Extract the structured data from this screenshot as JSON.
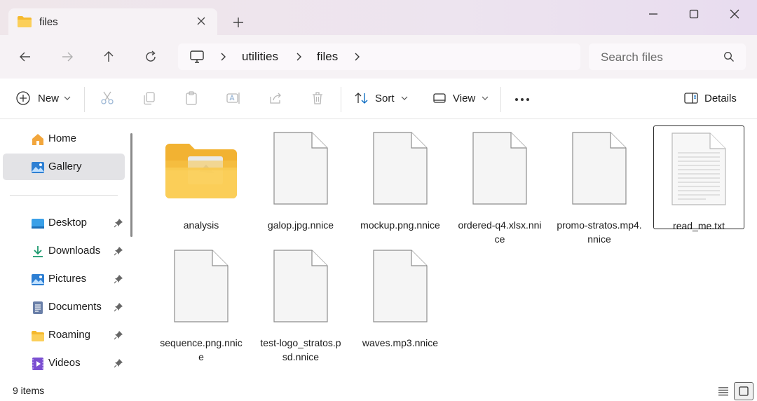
{
  "tab": {
    "title": "files"
  },
  "address": {
    "crumbs": [
      "utilities",
      "files"
    ]
  },
  "search": {
    "placeholder": "Search files"
  },
  "toolbar": {
    "new_label": "New",
    "sort_label": "Sort",
    "view_label": "View",
    "details_label": "Details"
  },
  "sidebar": {
    "items": [
      {
        "label": "Home",
        "icon": "home-icon"
      },
      {
        "label": "Gallery",
        "icon": "gallery-icon"
      },
      {
        "label": "Desktop",
        "icon": "desktop-icon"
      },
      {
        "label": "Downloads",
        "icon": "downloads-icon"
      },
      {
        "label": "Pictures",
        "icon": "pictures-icon"
      },
      {
        "label": "Documents",
        "icon": "documents-icon"
      },
      {
        "label": "Roaming",
        "icon": "folder-icon"
      },
      {
        "label": "Videos",
        "icon": "videos-icon"
      }
    ]
  },
  "files": [
    {
      "name": "analysis",
      "type": "folder"
    },
    {
      "name": "galop.jpg.nnice",
      "type": "file"
    },
    {
      "name": "mockup.png.nnice",
      "type": "file"
    },
    {
      "name": "ordered-q4.xlsx.nnice",
      "type": "file"
    },
    {
      "name": "promo-stratos.mp4.nnice",
      "type": "file"
    },
    {
      "name": "read_me.txt",
      "type": "text",
      "selected": true
    },
    {
      "name": "sequence.png.nnice",
      "type": "file"
    },
    {
      "name": "test-logo_stratos.psd.nnice",
      "type": "file"
    },
    {
      "name": "waves.mp3.nnice",
      "type": "file"
    }
  ],
  "status": {
    "item_count": "9 items"
  },
  "colors": {
    "accent": "#0067c0",
    "titlebar": "#efe6ea",
    "folder": "#f8c74a",
    "selected_bg": "#e3e3e6"
  }
}
